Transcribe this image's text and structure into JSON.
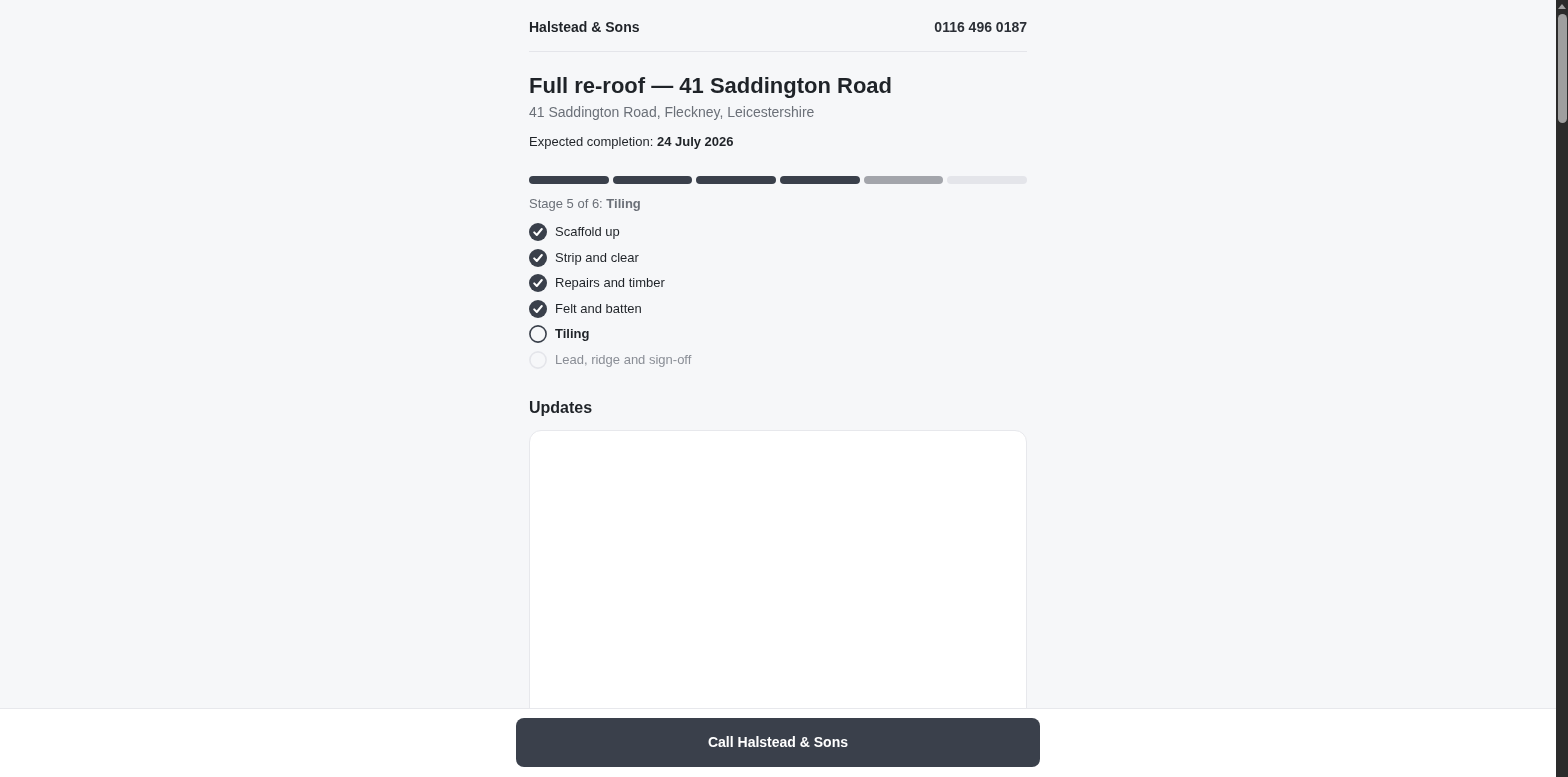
{
  "header": {
    "company": "Halstead & Sons",
    "phone": "0116 496 0187"
  },
  "job": {
    "title": "Full re-roof — 41 Saddington Road",
    "address": "41 Saddington Road, Fleckney, Leicestershire",
    "completion": "Expected completion: **24 July 2026**"
  },
  "progress": {
    "stage_label": "Stage 5 of 6: **Tiling**",
    "stages": [
      {
        "label": "Scaffold up",
        "done": true,
        "current": false
      },
      {
        "label": "Strip and clear",
        "done": true,
        "current": false
      },
      {
        "label": "Repairs and timber",
        "done": true,
        "current": false
      },
      {
        "label": "Felt and batten",
        "done": true,
        "current": false
      },
      {
        "label": "Tiling",
        "done": false,
        "current": true
      },
      {
        "label": "Lead, ridge and sign-off",
        "done": false,
        "current": false
      }
    ]
  },
  "updates": {
    "heading": "Updates"
  },
  "footer": {
    "button": "Call Halstead & Sons"
  }
}
